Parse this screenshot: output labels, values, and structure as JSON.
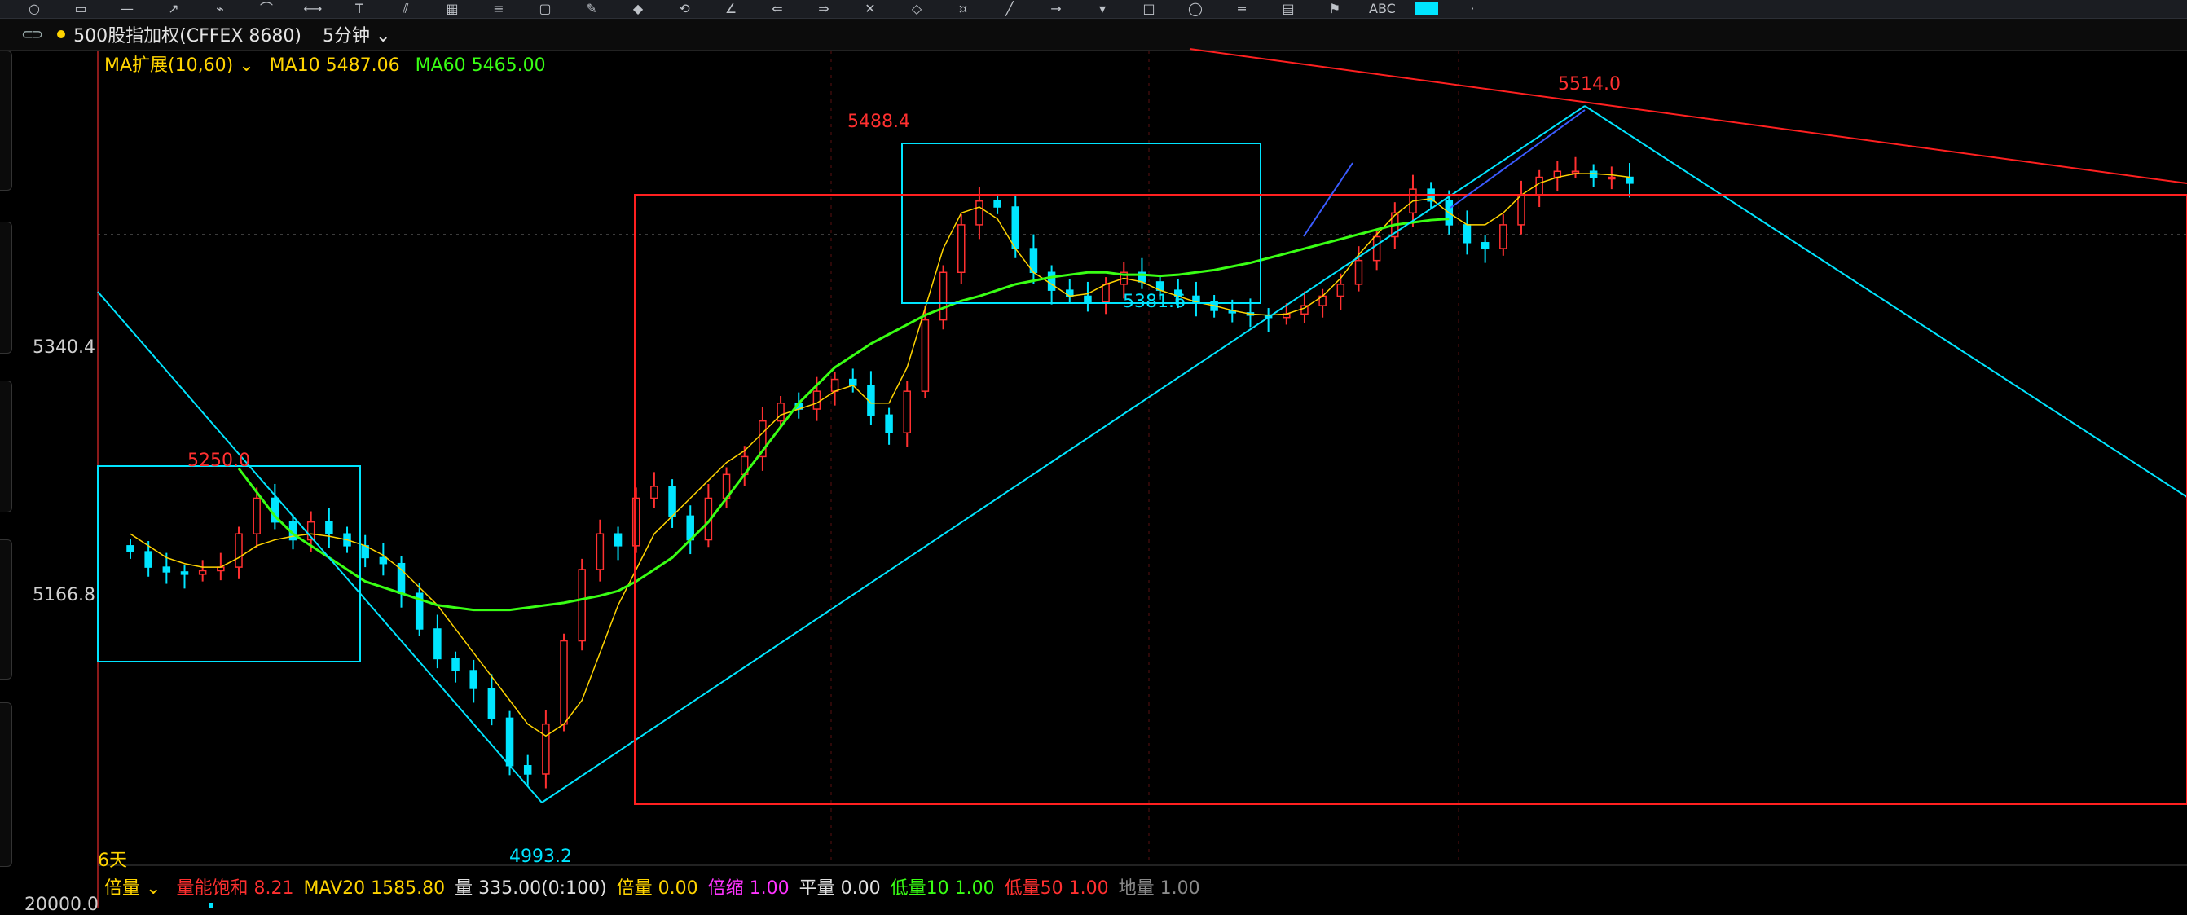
{
  "window": {
    "toolbar_icons": [
      "circle-icon",
      "window-icon",
      "line-icon",
      "arrow-icon",
      "draw-icon",
      "curve-icon",
      "measure-icon",
      "text-icon",
      "channel-icon",
      "grid-icon",
      "fib-icon",
      "box-icon",
      "pen-icon",
      "marker-icon",
      "cycle-icon",
      "angle-icon",
      "arrow-left-icon",
      "arrow-right-icon",
      "cross-icon",
      "diamond-icon",
      "price-icon",
      "segment-icon",
      "ray-icon",
      "down-icon",
      "rect-icon",
      "circle2-icon",
      "hline-icon",
      "bars-icon",
      "flag-icon",
      "abc-icon",
      "color-icon",
      "gallery-icon"
    ]
  },
  "header": {
    "symbol": "500股指加权(CFFEX 8680)",
    "period": "5分钟"
  },
  "ma_legend": {
    "selector": "MA扩展(10,60)",
    "ma10_label": "MA10",
    "ma10_value": "5487.06",
    "ma60_label": "MA60",
    "ma60_value": "5465.00",
    "ma10_color": "#ffd400",
    "ma60_color": "#39ff14"
  },
  "y_axis": {
    "labels": [
      "5340.4",
      "5166.8",
      "20000.0"
    ]
  },
  "days_label": "6天",
  "volume_legend": {
    "selector": "倍量",
    "items": [
      {
        "label": "量能饱和",
        "value": "8.21",
        "color": "#ff3030"
      },
      {
        "label": "MAV20",
        "value": "1585.80",
        "color": "#ffd400"
      },
      {
        "label": "量",
        "value": "335.00(0:100)",
        "color": "#e0e0e0"
      },
      {
        "label": "倍量",
        "value": "0.00",
        "color": "#ffd400"
      },
      {
        "label": "倍缩",
        "value": "1.00",
        "color": "#ff33ff"
      },
      {
        "label": "平量",
        "value": "0.00",
        "color": "#e0e0e0"
      },
      {
        "label": "低量10",
        "value": "1.00",
        "color": "#39ff14"
      },
      {
        "label": "低量50",
        "value": "1.00",
        "color": "#ff3030"
      },
      {
        "label": "地量",
        "value": "1.00",
        "color": "#8a8a8a"
      }
    ]
  },
  "chart_data": {
    "type": "candlestick",
    "instrument": "500股指加权(CFFEX 8680)",
    "interval": "5分钟",
    "colors": {
      "up": "#ff3030",
      "down": "#00e5ff",
      "ma10": "#ffd400",
      "ma60": "#39ff14",
      "trend": "#00e5ff",
      "box": "#ff2020"
    },
    "key_points": [
      {
        "x": 6,
        "y": 5250.0,
        "label": "5250.0"
      },
      {
        "x": 21,
        "y": 4993.2,
        "label": "4993.2"
      },
      {
        "x": 35,
        "y": 5488.4,
        "label": "5488.4"
      },
      {
        "x": 48,
        "y": 5381.6,
        "label": "5381.6"
      },
      {
        "x": 68,
        "y": 5514.0,
        "label": "5514.0"
      }
    ],
    "close": [
      5185,
      5172,
      5168,
      5166,
      5169,
      5172,
      5200,
      5230,
      5210,
      5195,
      5210,
      5200,
      5190,
      5180,
      5175,
      5150,
      5120,
      5095,
      5085,
      5070,
      5045,
      5005,
      4998,
      5040,
      5110,
      5170,
      5200,
      5190,
      5230,
      5240,
      5215,
      5195,
      5230,
      5250,
      5265,
      5295,
      5310,
      5305,
      5320,
      5330,
      5325,
      5300,
      5285,
      5320,
      5380,
      5420,
      5460,
      5480,
      5475,
      5440,
      5420,
      5405,
      5400,
      5395,
      5410,
      5420,
      5412,
      5405,
      5400,
      5395,
      5388,
      5386,
      5384,
      5382,
      5385,
      5392,
      5400,
      5410,
      5430,
      5450,
      5470,
      5490,
      5480,
      5460,
      5445,
      5440,
      5460,
      5485,
      5500,
      5505,
      5505,
      5500,
      5500,
      5495
    ],
    "ma10": [
      5200,
      5190,
      5180,
      5175,
      5172,
      5172,
      5180,
      5190,
      5195,
      5198,
      5200,
      5198,
      5195,
      5190,
      5182,
      5170,
      5155,
      5140,
      5120,
      5100,
      5080,
      5060,
      5040,
      5030,
      5040,
      5060,
      5100,
      5140,
      5170,
      5200,
      5215,
      5230,
      5245,
      5260,
      5270,
      5285,
      5300,
      5305,
      5310,
      5320,
      5325,
      5310,
      5310,
      5340,
      5390,
      5440,
      5470,
      5475,
      5465,
      5440,
      5420,
      5410,
      5400,
      5402,
      5410,
      5415,
      5412,
      5405,
      5400,
      5395,
      5392,
      5388,
      5385,
      5384,
      5385,
      5390,
      5400,
      5415,
      5435,
      5452,
      5468,
      5480,
      5482,
      5470,
      5460,
      5460,
      5470,
      5485,
      5495,
      5500,
      5503,
      5503,
      5502,
      5500
    ],
    "ma60": [
      null,
      null,
      null,
      null,
      null,
      null,
      5255,
      5235,
      5215,
      5200,
      5190,
      5180,
      5170,
      5160,
      5155,
      5150,
      5145,
      5140,
      5138,
      5136,
      5136,
      5136,
      5138,
      5140,
      5142,
      5145,
      5148,
      5152,
      5160,
      5170,
      5180,
      5195,
      5210,
      5230,
      5250,
      5270,
      5290,
      5310,
      5325,
      5340,
      5350,
      5360,
      5368,
      5376,
      5384,
      5390,
      5396,
      5400,
      5405,
      5410,
      5413,
      5416,
      5418,
      5420,
      5420,
      5418,
      5418,
      5417,
      5418,
      5420,
      5422,
      5425,
      5428,
      5432,
      5436,
      5440,
      5444,
      5448,
      5452,
      5456,
      5460,
      5462,
      5464,
      5465
    ]
  }
}
